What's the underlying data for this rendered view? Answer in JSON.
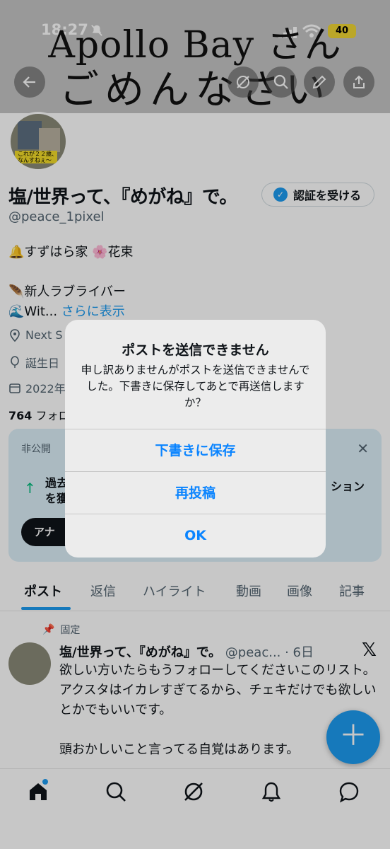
{
  "overlay": {
    "line1": "Apollo Bay さん",
    "line2": "ごめんなさい"
  },
  "statusbar": {
    "time": "18:27",
    "battery": "40"
  },
  "profile": {
    "name": "塩/世界って、『めがね』で。",
    "verify_label": "認証を受ける",
    "handle": "@peace_1pixel",
    "bio_line1": "🔔すずはら家 🌸花束",
    "bio_line2": "🪶新人ラブライバー",
    "bio_line3": "🌊Wit...",
    "show_more": "さらに表示",
    "location": "Next S",
    "birthday": "誕生日",
    "joined": "2022年",
    "following_count": "764",
    "following_label": "フォロ",
    "avatar_text": "これが２２歳、なんすねぇ～"
  },
  "promo": {
    "label": "非公開",
    "text_left": "過去",
    "text_left2": "を獲",
    "text_right": "ション",
    "button": "アナ"
  },
  "tabs": [
    "ポスト",
    "返信",
    "ハイライト",
    "動画",
    "画像",
    "記事"
  ],
  "post": {
    "pinned": "固定",
    "author": "塩/世界って、『めがね』で。",
    "handle_time": "@peac... · 6日",
    "body": [
      "欲しい方いたらもうフォローしてくださいこのリスト。",
      "アクスタはイカレすぎてるから、チェキだけでも欲しいとかでもいいです。",
      "",
      "頭おかしいこと言ってる自覚はあります。"
    ]
  },
  "alert": {
    "title": "ポストを送信できません",
    "message": "申し訳ありませんがポストを送信できませんでした。下書きに保存してあとで再送信しますか？",
    "save_draft": "下書きに保存",
    "retry": "再投稿",
    "ok": "OK"
  },
  "icons": {
    "back": "back-arrow-icon",
    "grok": "grok-icon",
    "search": "search-icon",
    "edit": "pencil-icon",
    "share": "share-icon",
    "nav": [
      "home-icon",
      "search-icon",
      "grok-icon",
      "notifications-icon",
      "messages-icon"
    ]
  },
  "colors": {
    "accent": "#1d9bf0",
    "alert_button": "#0a84ff"
  }
}
